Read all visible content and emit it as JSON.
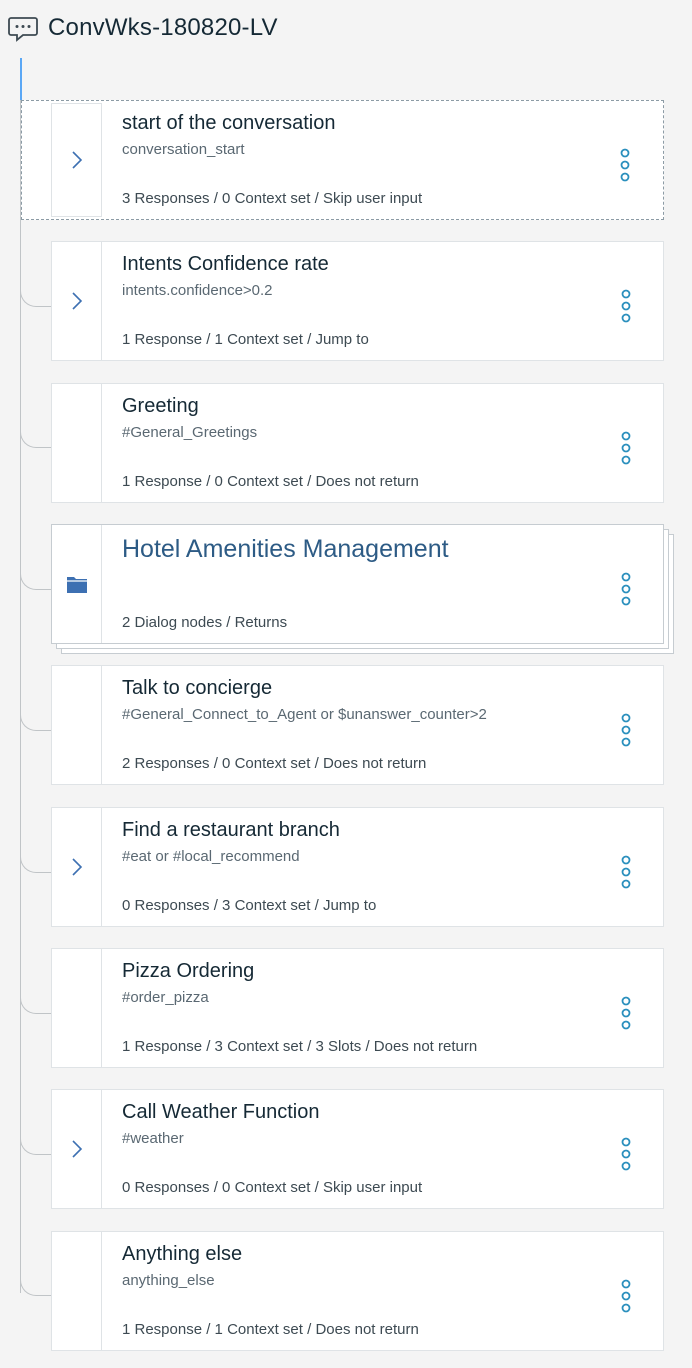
{
  "workspace": {
    "title": "ConvWks-180820-LV"
  },
  "nodes": [
    {
      "title": "start of the conversation",
      "condition": "conversation_start",
      "meta": "3 Responses / 0 Context set / Skip user input"
    },
    {
      "title": "Intents Confidence rate",
      "condition": "intents.confidence>0.2",
      "meta": "1 Response / 1 Context set / Jump to"
    },
    {
      "title": "Greeting",
      "condition": "#General_Greetings",
      "meta": "1 Response / 0 Context set / Does not return"
    },
    {
      "title": "Hotel Amenities Management",
      "condition": "",
      "meta": "2 Dialog nodes / Returns"
    },
    {
      "title": "Talk to concierge",
      "condition": "#General_Connect_to_Agent or $unanswer_counter>2",
      "meta": "2 Responses / 0 Context set / Does not return"
    },
    {
      "title": "Find a restaurant branch",
      "condition": "#eat or #local_recommend",
      "meta": "0 Responses / 3 Context set / Jump to"
    },
    {
      "title": "Pizza Ordering",
      "condition": "#order_pizza",
      "meta": "1 Response / 3 Context set / 3 Slots / Does not return"
    },
    {
      "title": "Call Weather Function",
      "condition": "#weather",
      "meta": "0 Responses / 0 Context set / Skip user input"
    },
    {
      "title": "Anything else",
      "condition": "anything_else",
      "meta": "1 Response / 1 Context set / Does not return"
    }
  ],
  "icons": {
    "workspace": "chat-bubble-icon",
    "expand": "chevron-right-icon",
    "folder": "folder-icon",
    "menu": "overflow-menu-vertical-icon"
  },
  "colors": {
    "accent": "#3d70b2",
    "link_blue": "#2d5b85",
    "menu_dot": "#2a8fbd",
    "tree_active": "#5aa7f5"
  }
}
